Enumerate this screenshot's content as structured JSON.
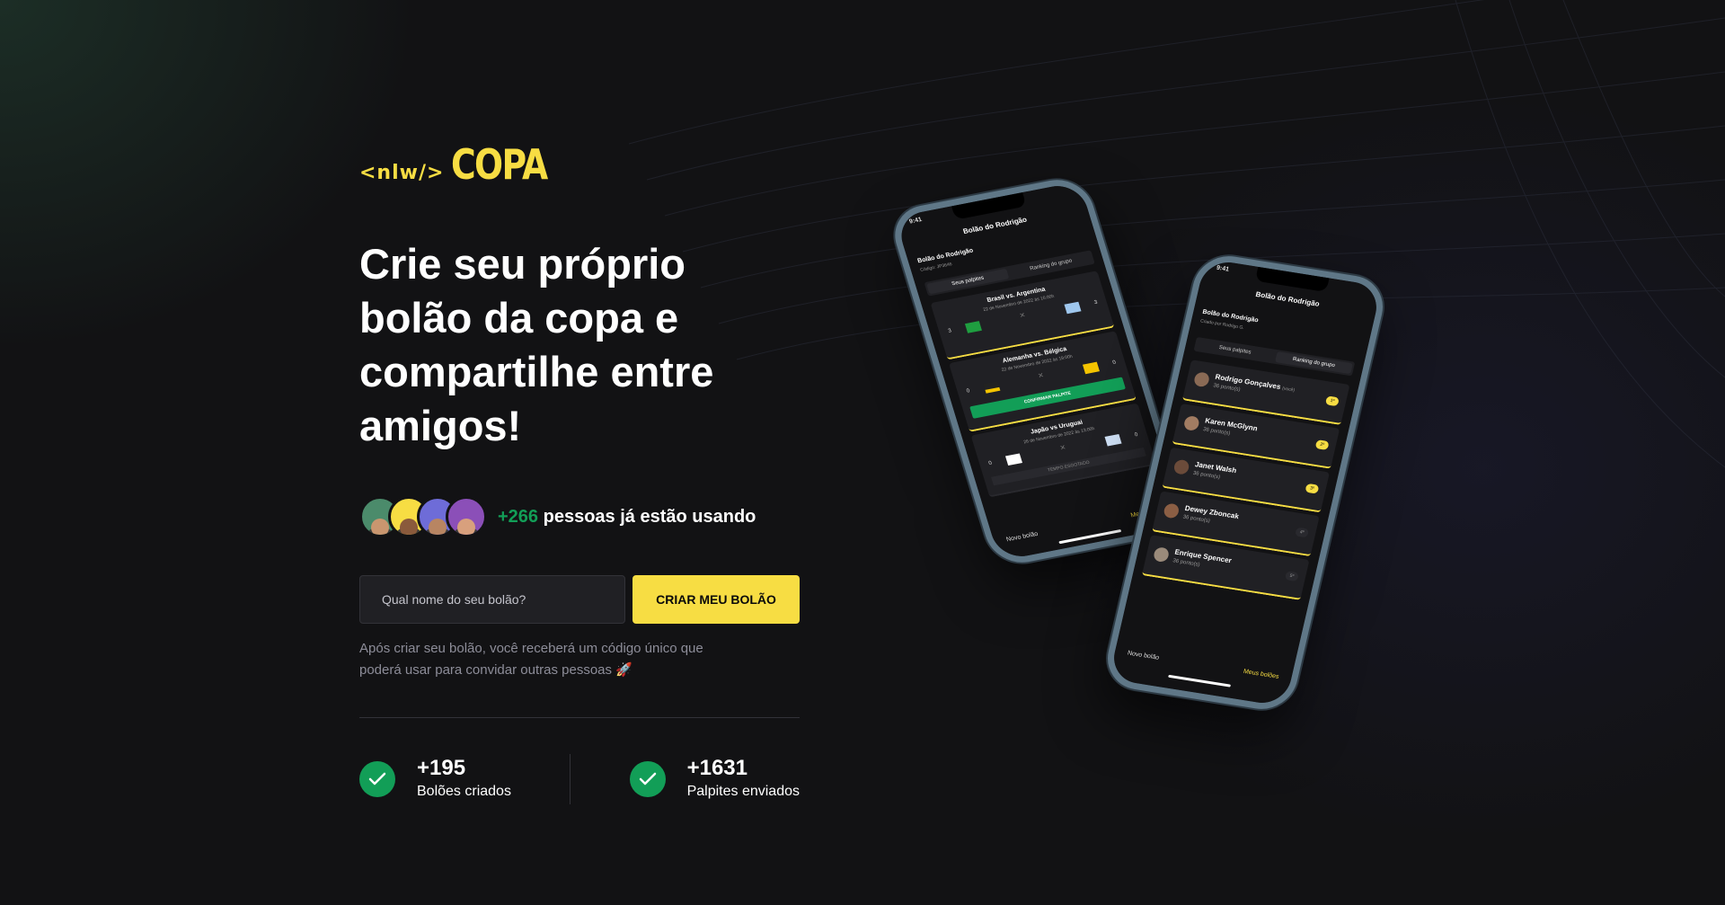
{
  "brand": {
    "code": "<nlw/>",
    "name": "COPA",
    "accent": "#F7DD43"
  },
  "hero": {
    "title": "Crie seu próprio bolão da copa e compartilhe entre amigos!"
  },
  "social_proof": {
    "count": "+266",
    "text": " pessoas já estão usando",
    "accent": "#129E57"
  },
  "form": {
    "placeholder": "Qual nome do seu bolão?",
    "button_label": "Criar meu bolão"
  },
  "hint": "Após criar seu bolão, você receberá um código único que poderá usar para convidar outras pessoas 🚀",
  "stats": [
    {
      "value": "+195",
      "label": "Bolões criados"
    },
    {
      "value": "+1631",
      "label": "Palpites enviados"
    }
  ],
  "phone_back": {
    "time": "9:41",
    "header": "Bolão do Rodrigão",
    "pool_title": "Bolão do Rodrigão",
    "pool_code": "Código: JP3646",
    "tab_1": "Seus palpites",
    "tab_2": "Ranking do grupo",
    "matches": [
      {
        "title": "Brasil vs. Argentina",
        "date": "22 de Novembro de 2022 às 16:00h",
        "left": "3",
        "right": "3"
      },
      {
        "title": "Alemanha vs. Bélgica",
        "date": "22 de Novembro de 2022 às 19:00h",
        "left": "0",
        "right": "0",
        "action": "CONFIRMAR PALPITE"
      },
      {
        "title": "Japão vs Uruguai",
        "date": "26 de Novembro de 2022 às 13:00h",
        "left": "0",
        "right": "0",
        "status": "TEMPO ESGOTADO"
      }
    ],
    "nav_1": "Novo bolão",
    "nav_2": "Meus bolões"
  },
  "phone_front": {
    "time": "9:41",
    "header": "Bolão do Rodrigão",
    "pool_title": "Bolão do Rodrigão",
    "pool_owner": "Criado por Rodrigo G.",
    "tab_1": "Seus palpites",
    "tab_2": "Ranking do grupo",
    "ranking": [
      {
        "name": "Rodrigo Gonçalves",
        "tag": "(você)",
        "points": "36 ponto(s)",
        "pos": "1º"
      },
      {
        "name": "Karen McGlynn",
        "tag": "",
        "points": "36 ponto(s)",
        "pos": "2º"
      },
      {
        "name": "Janet Walsh",
        "tag": "",
        "points": "36 ponto(s)",
        "pos": "3º"
      },
      {
        "name": "Dewey Zboncak",
        "tag": "",
        "points": "36 ponto(s)",
        "pos": "4º"
      },
      {
        "name": "Enrique Spencer",
        "tag": "",
        "points": "36 ponto(s)",
        "pos": "5º"
      }
    ],
    "nav_1": "Novo bolão",
    "nav_2": "Meus bolões"
  }
}
